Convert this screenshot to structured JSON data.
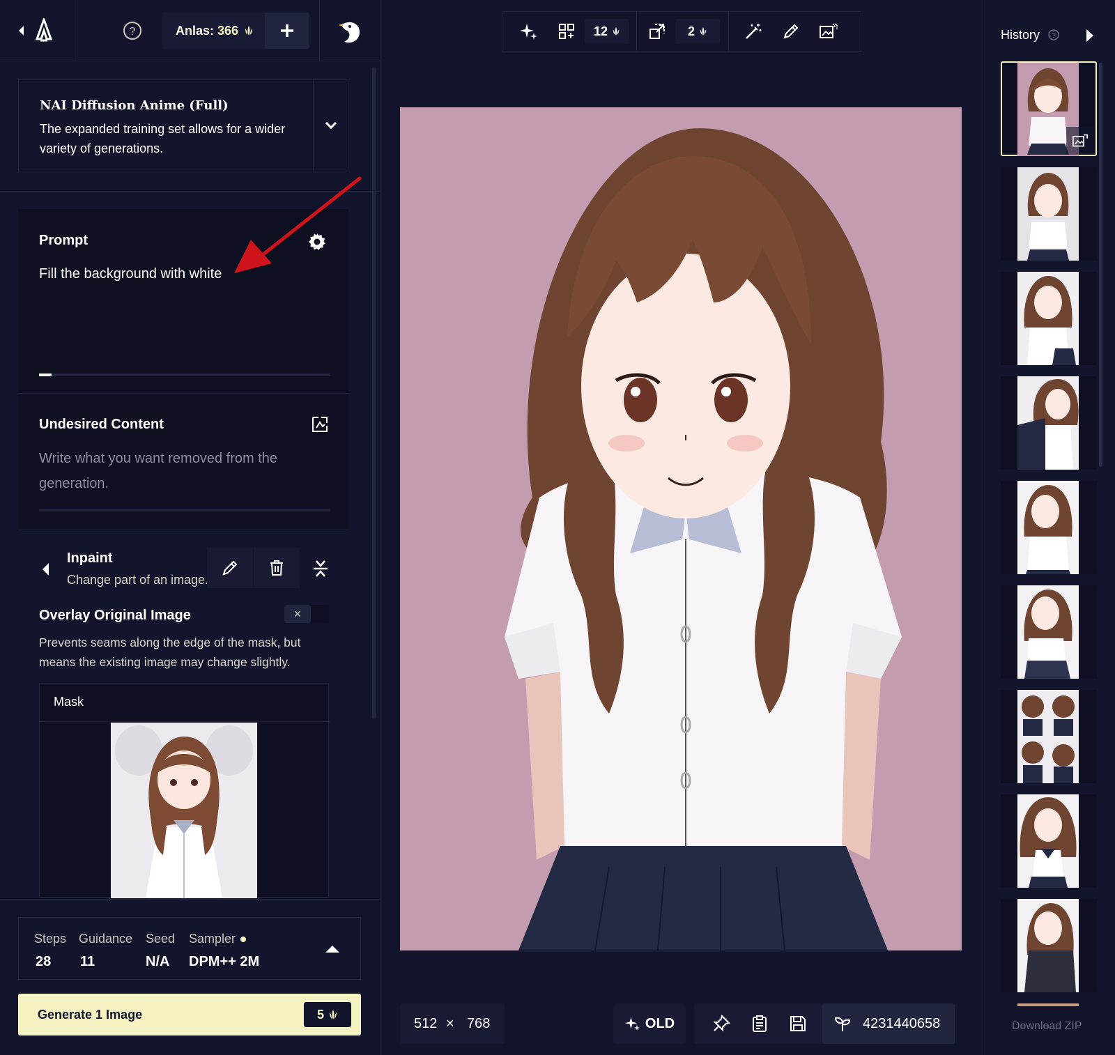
{
  "header": {
    "anlas_label": "Anlas:",
    "anlas_amount": "366"
  },
  "model": {
    "name": "NAI Diffusion Anime (Full)",
    "description": "The expanded training set allows for a wider variety of generations."
  },
  "prompt": {
    "title": "Prompt",
    "text": "Fill the background with white"
  },
  "undesired": {
    "title": "Undesired Content",
    "placeholder": "Write what you want removed from the generation."
  },
  "inpaint": {
    "title": "Inpaint",
    "description": "Change part of an image."
  },
  "overlay": {
    "title": "Overlay Original Image",
    "toggle_symbol": "✕",
    "description": "Prevents seams along the edge of the mask, but means the existing image may change slightly."
  },
  "mask": {
    "label": "Mask"
  },
  "params": {
    "steps_label": "Steps",
    "steps_value": "28",
    "guidance_label": "Guidance",
    "guidance_value": "11",
    "seed_label": "Seed",
    "seed_value": "N/A",
    "sampler_label": "Sampler",
    "sampler_value": "DPM++ 2M"
  },
  "generate": {
    "label": "Generate 1 Image",
    "cost": "5"
  },
  "toolbar": {
    "images_count": "12",
    "upscale_count": "2"
  },
  "canvas": {
    "width": "512",
    "times": "×",
    "height": "768",
    "old_label": "OLD",
    "seed": "4231440658"
  },
  "history": {
    "title": "History",
    "download_label": "Download ZIP",
    "selected_index": 0
  },
  "colors": {
    "background": "#13152c",
    "panel": "#0e0f21",
    "accent": "#f5f3c2",
    "canvas_bg": "#c39cb0",
    "annotation_arrow": "#d0141c"
  },
  "icons": [
    "back-chevron-icon",
    "nai-logo-icon",
    "help-icon",
    "plus-icon",
    "penguin-avatar-icon",
    "sparkle-icon",
    "grid-icon",
    "upscale-icon",
    "magic-wand-icon",
    "pen-icon",
    "inpaint-icon",
    "gear-icon",
    "enhance-icon",
    "chevron-down-icon",
    "trash-icon",
    "collapse-icon",
    "chevron-up-icon",
    "anlas-icon",
    "pin-icon",
    "clipboard-icon",
    "save-icon",
    "seed-icon",
    "play-icon"
  ]
}
